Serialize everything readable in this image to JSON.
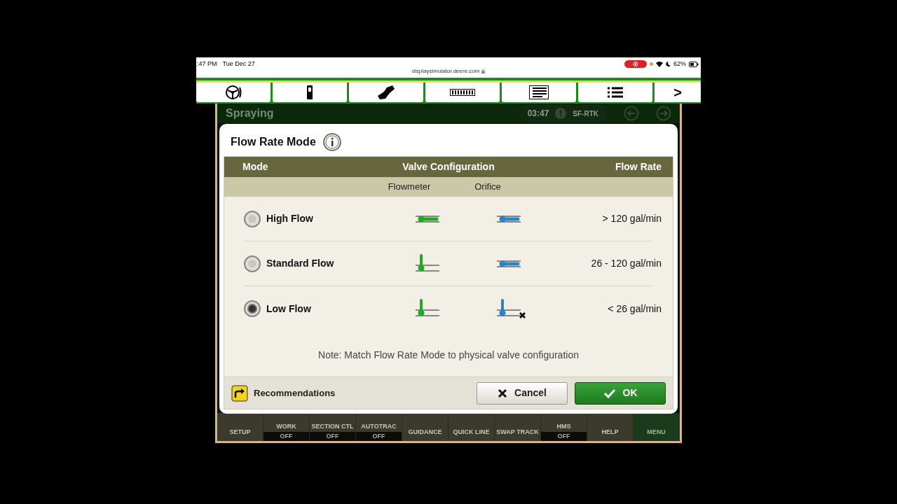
{
  "status_bar": {
    "time": ":47 PM",
    "date": "Tue Dec 27",
    "url": "displaysimulator.deere.com",
    "battery": "62%"
  },
  "nav_arrow": ">",
  "header": {
    "title": "Spraying",
    "time": "03:47",
    "signal": "SF-RTK"
  },
  "dialog": {
    "title": "Flow Rate Mode",
    "columns": [
      "Mode",
      "Valve Configuration",
      "Flow Rate"
    ],
    "subcolumns": [
      "Flowmeter",
      "Orifice"
    ],
    "rows": [
      {
        "label": "High Flow",
        "selected": false,
        "flowmeter": {
          "kind": "open"
        },
        "orifice": {
          "kind": "open",
          "crossed": false
        },
        "rate": "> 120 gal/min"
      },
      {
        "label": "Standard Flow",
        "selected": false,
        "flowmeter": {
          "kind": "closed"
        },
        "orifice": {
          "kind": "open",
          "crossed": false
        },
        "rate": "26 - 120 gal/min"
      },
      {
        "label": "Low Flow",
        "selected": true,
        "flowmeter": {
          "kind": "closed"
        },
        "orifice": {
          "kind": "closed",
          "crossed": true
        },
        "rate": "< 26 gal/min"
      }
    ],
    "note": "Note: Match Flow Rate Mode to physical valve configuration",
    "recommendations": "Recommendations",
    "cancel": "Cancel",
    "ok": "OK"
  },
  "bottom_bar": [
    {
      "label": "SETUP",
      "selected": false
    },
    {
      "label": "WORK",
      "status": "OFF",
      "selected": false
    },
    {
      "label": "SECTION CTL",
      "status": "OFF",
      "selected": false
    },
    {
      "label": "AUTOTRAC",
      "status": "OFF",
      "selected": false
    },
    {
      "label": "GUIDANCE",
      "selected": false
    },
    {
      "label": "QUICK LINE",
      "selected": false
    },
    {
      "label": "SWAP TRACK",
      "selected": false
    },
    {
      "label": "HMS",
      "status": "OFF",
      "selected": false
    },
    {
      "label": "HELP",
      "selected": false
    },
    {
      "label": "MENU",
      "selected": true
    }
  ]
}
